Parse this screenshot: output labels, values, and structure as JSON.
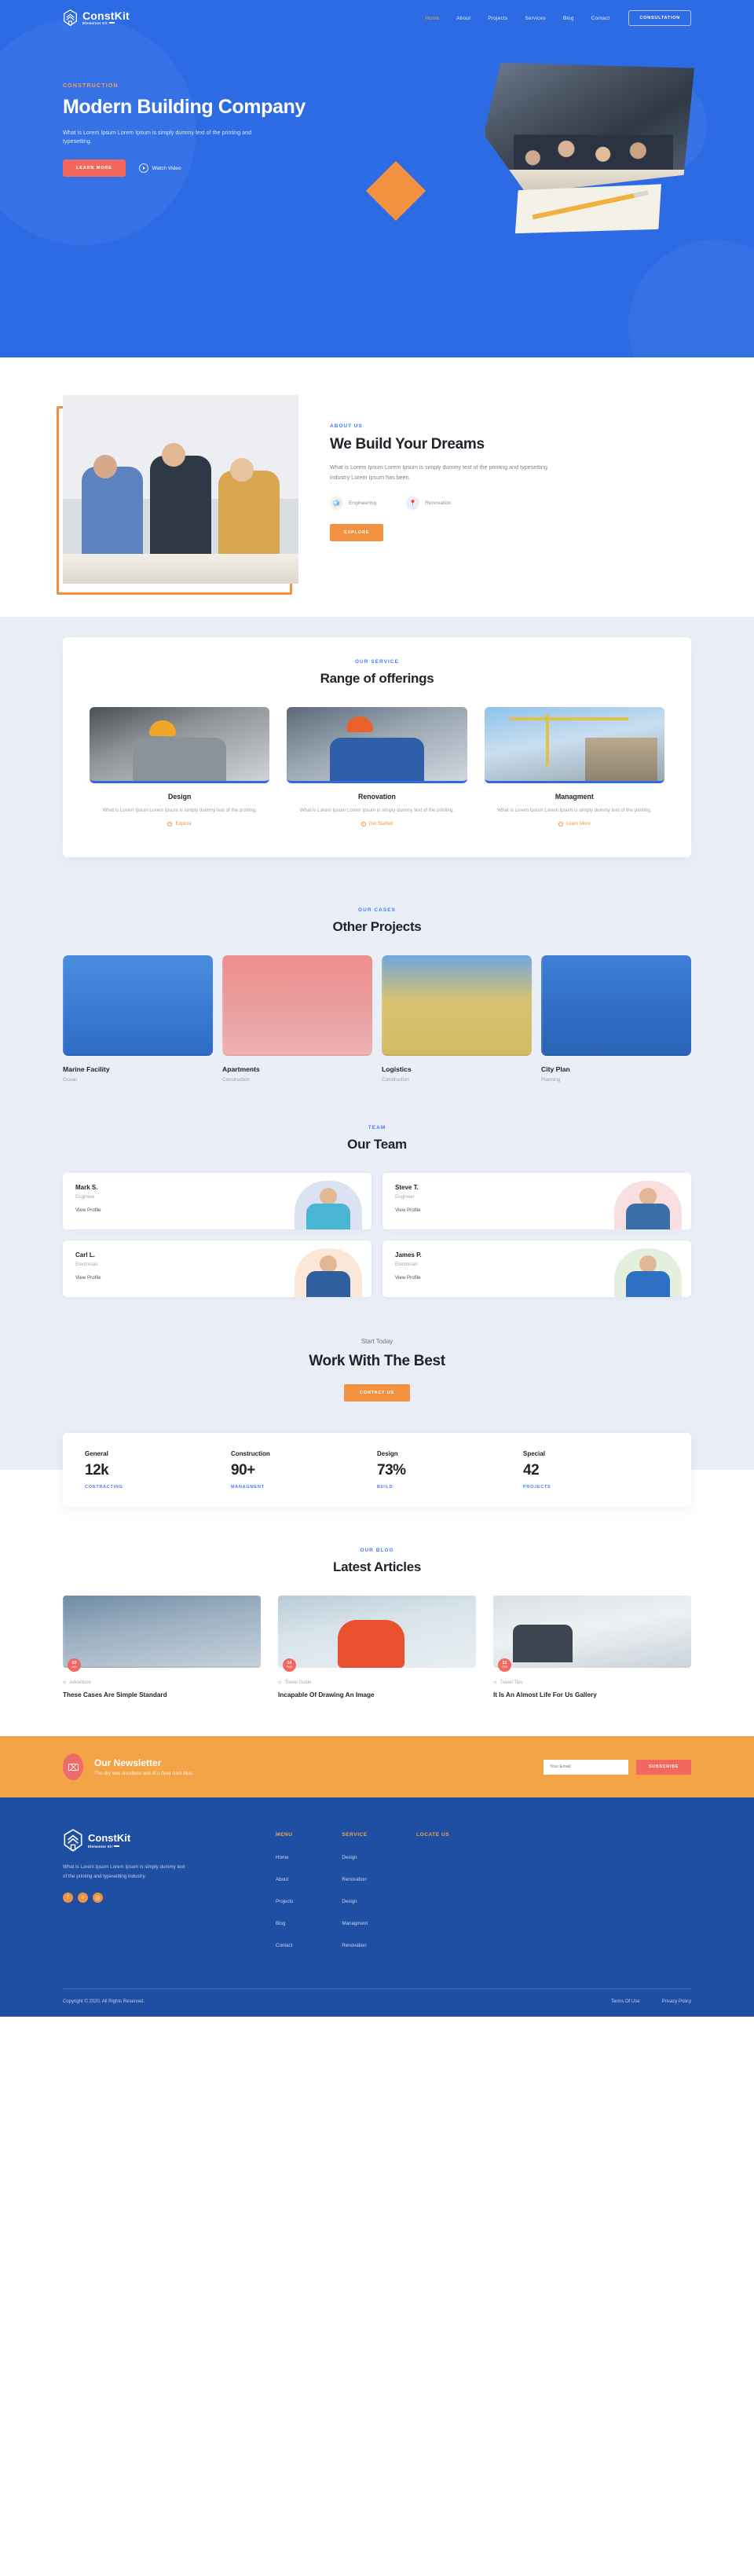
{
  "brand": {
    "name": "ConstKit",
    "sub": "Elementor Kit"
  },
  "nav": {
    "items": [
      {
        "label": "Home",
        "active": true
      },
      {
        "label": "About",
        "active": false
      },
      {
        "label": "Projects",
        "active": false
      },
      {
        "label": "Services",
        "active": false
      },
      {
        "label": "Blog",
        "active": false
      },
      {
        "label": "Contact",
        "active": false
      }
    ],
    "cta": "CONSULTATION"
  },
  "hero": {
    "eyebrow": "CONSTRUCTION",
    "title": "Modern Building Company",
    "desc": "What is Lorem Ipsum Lorem Ipsum is simply dummy text of the printing and typesetting.",
    "primary_btn": "LEARN MORE",
    "video_label": "Watch Video"
  },
  "about": {
    "eyebrow": "ABOUT US",
    "title": "We Build Your Dreams",
    "text": "What is Lorem Ipsum Lorem Ipsum is simply dummy text of the printing and typesetting industry Lorem Ipsum has been.",
    "features": [
      {
        "label": "Engineering",
        "icon": "cube-icon"
      },
      {
        "label": "Renovation",
        "icon": "pin-icon"
      }
    ],
    "button": "EXPLORE"
  },
  "services": {
    "eyebrow": "OUR SERVICE",
    "title": "Range of offerings",
    "items": [
      {
        "name": "Design",
        "desc": "What is Lorem Ipsum Lorem Ipsum is simply dummy text of the printing.",
        "link": "Explore"
      },
      {
        "name": "Renovation",
        "desc": "What is Lorem Ipsum Lorem Ipsum is simply dummy text of the printing.",
        "link": "Get Started"
      },
      {
        "name": "Managment",
        "desc": "What is Lorem Ipsum Lorem Ipsum is simply dummy text of the printing.",
        "link": "Learn More"
      }
    ]
  },
  "projects": {
    "eyebrow": "OUR CASES",
    "title": "Other Projects",
    "items": [
      {
        "name": "Marine Facility",
        "category": "Ocean"
      },
      {
        "name": "Apartments",
        "category": "Construction"
      },
      {
        "name": "Logistics",
        "category": "Construction"
      },
      {
        "name": "City Plan",
        "category": "Planning"
      }
    ]
  },
  "team": {
    "eyebrow": "TEAM",
    "title": "Our Team",
    "members": [
      {
        "name": "Mark S.",
        "role": "Engineer",
        "link": "View Profile"
      },
      {
        "name": "Steve T.",
        "role": "Engineer",
        "link": "View Profile"
      },
      {
        "name": "Carl L.",
        "role": "Electrician",
        "link": "View Profile"
      },
      {
        "name": "James P.",
        "role": "Electrician",
        "link": "View Profile"
      }
    ]
  },
  "cta_section": {
    "small": "Start Today",
    "title": "Work With The Best",
    "button": "CONTACT US"
  },
  "stats": [
    {
      "label": "General",
      "value": "12k",
      "category": "CONTRACTING"
    },
    {
      "label": "Construction",
      "value": "90+",
      "category": "MANAGMENT"
    },
    {
      "label": "Design",
      "value": "73%",
      "category": "BUILD"
    },
    {
      "label": "Special",
      "value": "42",
      "category": "PROJECTS"
    }
  ],
  "blog": {
    "eyebrow": "OUR BLOG",
    "title": "Latest Articles",
    "posts": [
      {
        "day": "03",
        "month": "JAN",
        "category": "Adventure",
        "title": "These Cases Are Simple Standard"
      },
      {
        "day": "14",
        "month": "FEB",
        "category": "Travel Guide",
        "title": "Incapable Of Drawing An Image"
      },
      {
        "day": "22",
        "month": "FEB",
        "category": "Travel Tips",
        "title": "It Is An Almost Life For Us Gallery"
      }
    ]
  },
  "newsletter": {
    "title": "Our Newsletter",
    "sub": "The sky was cloudless and of a deep dark blue.",
    "placeholder": "Your Email",
    "button": "SUBSCRIBE"
  },
  "footer": {
    "desc": "What is Lorem Ipsum Lorem Ipsum is simply dummy text of the printing and typesetting industry.",
    "social": [
      {
        "name": "facebook-icon",
        "glyph": "f"
      },
      {
        "name": "twitter-icon",
        "glyph": "ᴠ"
      },
      {
        "name": "instagram-icon",
        "glyph": "◎"
      }
    ],
    "columns": [
      {
        "title": "MENU",
        "links": [
          "Home",
          "About",
          "Projects",
          "Blog",
          "Contact"
        ]
      },
      {
        "title": "SERVICE",
        "links": [
          "Design",
          "Renovation",
          "Design",
          "Managment",
          "Renovation"
        ]
      },
      {
        "title": "LOCATE US",
        "links": []
      }
    ],
    "copyright": "Copyright © 2020. All Rights Reserved.",
    "legal": [
      "Terms Of Use",
      "Privacy Policy"
    ]
  },
  "colors": {
    "primary_blue": "#2d6be4",
    "footer_blue": "#1f4fa3",
    "orange": "#f2913f",
    "newsletter_orange": "#f2a447",
    "red": "#f2685e",
    "light_bg": "#eaeef7"
  }
}
